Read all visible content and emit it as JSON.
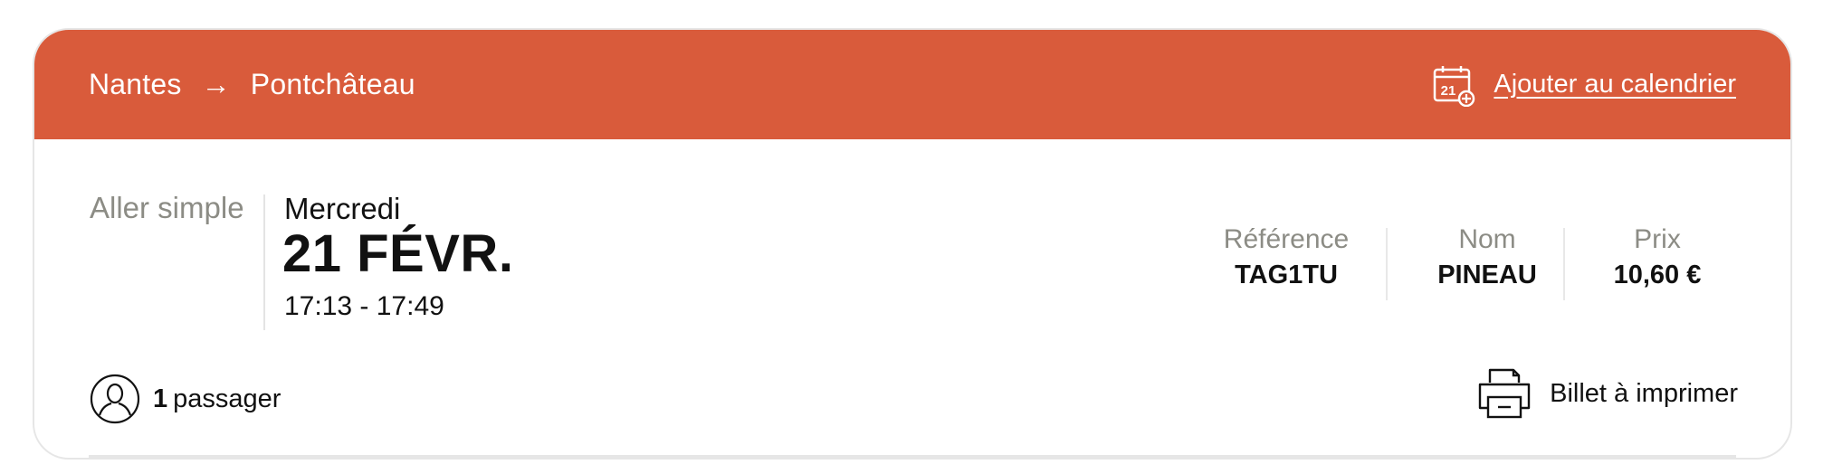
{
  "trip": {
    "origin": "Nantes",
    "arrow": "→",
    "destination": "Pontchâteau"
  },
  "calendar": {
    "icon": "calendar-add-icon",
    "icon_day": "21",
    "label": "Ajouter au calendrier"
  },
  "journey": {
    "type": "Aller simple",
    "weekday": "Mercredi",
    "date": "21 FÉVR.",
    "times": "17:13 - 17:49"
  },
  "details": [
    {
      "label": "Référence",
      "value": "TAG1TU"
    },
    {
      "label": "Nom",
      "value": "PINEAU"
    },
    {
      "label": "Prix",
      "value": "10,60 €"
    }
  ],
  "passengers": {
    "count": "1",
    "label": "passager",
    "icon": "user-icon"
  },
  "ticket": {
    "icon": "printer-icon",
    "label": "Billet à imprimer"
  },
  "colors": {
    "banner": "#d95b3b",
    "muted_text": "#8c8c85"
  }
}
